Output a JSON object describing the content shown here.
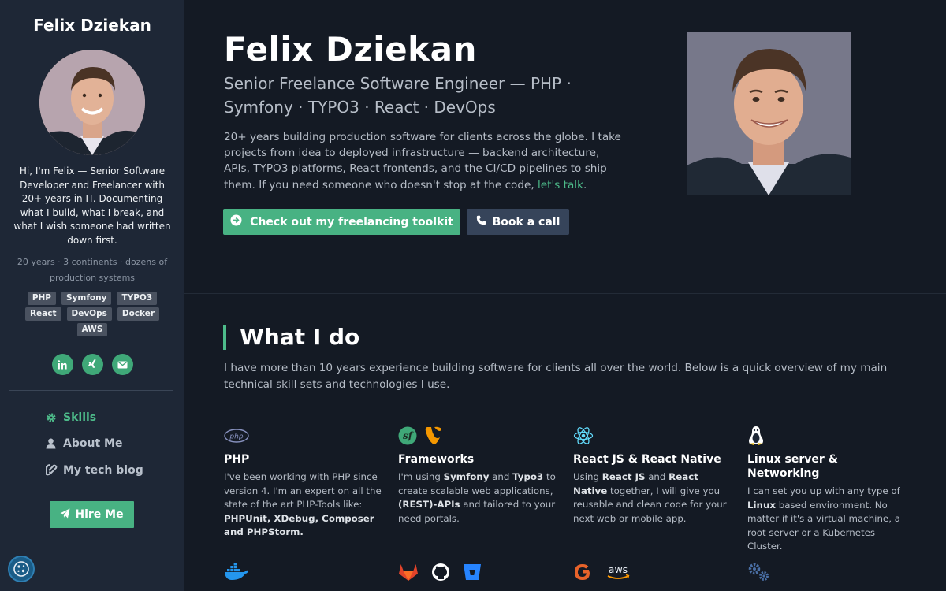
{
  "sidebar": {
    "name": "Felix Dziekan",
    "intro": "Hi, I'm Felix — Senior Software Developer and Freelancer with 20+ years in IT. Documenting what I build, what I break, and what I wish someone had written down first.",
    "meta": "20 years · 3 continents · dozens of production systems",
    "tags": [
      "PHP",
      "Symfony",
      "TYPO3",
      "React",
      "DevOps",
      "Docker",
      "AWS"
    ],
    "socials": [
      "linkedin-icon",
      "xing-icon",
      "email-icon"
    ],
    "nav": [
      {
        "label": "Skills",
        "icon": "gear-icon",
        "active": true
      },
      {
        "label": "About Me",
        "icon": "user-icon",
        "active": false
      },
      {
        "label": "My tech blog",
        "icon": "blog-icon",
        "active": false
      }
    ],
    "hire_label": "Hire Me"
  },
  "hero": {
    "name": "Felix Dziekan",
    "subtitle": "Senior Freelance Software Engineer — PHP · Symfony · TYPO3 · React · DevOps",
    "description": "20+ years building production software for clients across the globe. I take projects from idea to deployed infrastructure — backend architecture, APIs, TYPO3 platforms, React frontends, and the CI/CD pipelines to ship them. If you need someone who doesn't stop at the code,",
    "link_text": "let's talk",
    "link_suffix": ".",
    "primary_button": "Check out my freelancing toolkit",
    "secondary_button": "Book a call"
  },
  "what_i_do": {
    "title": "What I do",
    "intro": "I have more than 10 years experience building software for clients all over the world. Below is a quick overview of my main technical skill sets and technologies I use.",
    "skills": [
      {
        "title": "PHP",
        "icons": [
          "php-icon"
        ]
      },
      {
        "title": "Frameworks",
        "icons": [
          "symfony-icon",
          "typo3-icon"
        ]
      },
      {
        "title": "React JS & React Native",
        "icons": [
          "react-icon"
        ]
      },
      {
        "title": "Linux server & Networking",
        "icons": [
          "linux-icon"
        ]
      }
    ],
    "bottom_icons": [
      "docker-icon",
      "gitlab-icon",
      "github-icon",
      "bitbucket-icon",
      "google-icon",
      "aws-icon",
      "cogs-icon"
    ]
  },
  "skill_text": {
    "php": {
      "t1": "I've been working with PHP since version 4. I'm an expert on all the state of the art PHP-Tools like: ",
      "b1": "PHPUnit, XDebug, Composer and PHPStorm."
    },
    "frameworks": {
      "t1": "I'm using ",
      "b1": "Symfony",
      "t2": " and ",
      "b2": "Typo3",
      "t3": " to create scalable web applications, ",
      "b3": "(REST)-APIs",
      "t4": " and tailored to your need portals."
    },
    "react": {
      "t1": "Using ",
      "b1": "React JS",
      "t2": " and ",
      "b2": "React Native",
      "t3": " together, I will give you reusable and clean code for your next web or mobile app."
    },
    "linux": {
      "t1": "I can set you up with any type of ",
      "b1": "Linux",
      "t2": " based environment. No matter if it's a virtual machine, a root server or a Kubernetes Cluster."
    }
  },
  "colors": {
    "accent": "#48b283",
    "sidebar_bg": "#1e2736",
    "page_bg": "#141a24"
  }
}
